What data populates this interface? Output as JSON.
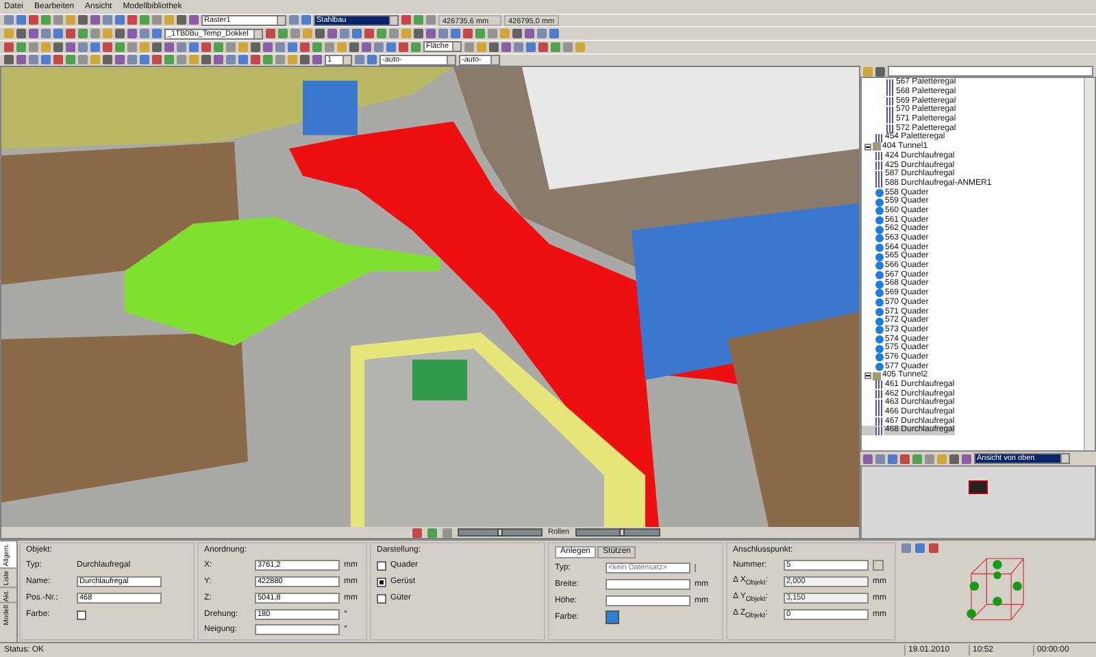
{
  "menu": [
    "Datei",
    "Bearbeiten",
    "Ansicht",
    "Modellbibliothek"
  ],
  "toolbar": {
    "layer": "Raster1",
    "material": "Stahlbau",
    "coord_x": "426735,6 mm",
    "coord_y": "426795,0 mm",
    "template": "_1TB0Bu_Temp_Dokkel",
    "fill": "Fläche",
    "size": "1",
    "auto_1": "-auto-",
    "auto_2": "-auto-"
  },
  "viewport": {
    "slider_label": "Rollen",
    "sliders": [
      {
        "level": 0.5
      },
      {
        "level": 0.55
      }
    ]
  },
  "tree": {
    "items": [
      {
        "children": [
          {
            "children": [
              {
                "label": "567 Paletteregal",
                "kind": "rack"
              },
              {
                "label": "568 Paletteregal",
                "kind": "rack"
              },
              {
                "label": "569 Paletteregal",
                "kind": "rack"
              },
              {
                "label": "570 Paletteregal",
                "kind": "rack"
              },
              {
                "label": "571 Paletteregal",
                "kind": "rack"
              },
              {
                "label": "572 Paletteregal",
                "kind": "rack"
              }
            ]
          },
          {
            "label": "454 Paletteregal",
            "kind": "rack"
          }
        ]
      },
      {
        "label": "404 Tunnel1",
        "kind": "group",
        "expanded": true,
        "children": [
          {
            "label": "424 Durchlaufregal",
            "kind": "rack"
          },
          {
            "label": "425 Durchlaufregal",
            "kind": "rack"
          },
          {
            "label": "587 Durchlaufregal",
            "kind": "rack"
          },
          {
            "label": "588 Durchlaufregal-ANMER1",
            "kind": "rack"
          },
          {
            "label": "558 Quader",
            "kind": "box"
          },
          {
            "label": "559 Quader",
            "kind": "box"
          },
          {
            "label": "560 Quader",
            "kind": "box"
          },
          {
            "label": "561 Quader",
            "kind": "box"
          },
          {
            "label": "562 Quader",
            "kind": "box"
          },
          {
            "label": "563 Quader",
            "kind": "box"
          },
          {
            "label": "564 Quader",
            "kind": "box"
          },
          {
            "label": "565 Quader",
            "kind": "box"
          },
          {
            "label": "566 Quader",
            "kind": "box"
          },
          {
            "label": "567 Quader",
            "kind": "box"
          },
          {
            "label": "568 Quader",
            "kind": "box"
          },
          {
            "label": "569 Quader",
            "kind": "box"
          },
          {
            "label": "570 Quader",
            "kind": "box"
          },
          {
            "label": "571 Quader",
            "kind": "box"
          },
          {
            "label": "572 Quader",
            "kind": "box"
          },
          {
            "label": "573 Quader",
            "kind": "box"
          },
          {
            "label": "574 Quader",
            "kind": "box"
          },
          {
            "label": "575 Quader",
            "kind": "box"
          },
          {
            "label": "576 Quader",
            "kind": "box"
          },
          {
            "label": "577 Quader",
            "kind": "box"
          }
        ]
      },
      {
        "label": "405 Tunnel2",
        "kind": "group",
        "expanded": true,
        "children": [
          {
            "label": "461 Durchlaufregal",
            "kind": "rack"
          },
          {
            "label": "462 Durchlaufregal",
            "kind": "rack"
          },
          {
            "label": "463 Durchlaufregal",
            "kind": "rack"
          },
          {
            "label": "466 Durchlaufregal",
            "kind": "rack"
          },
          {
            "label": "467 Durchlaufregal",
            "kind": "rack"
          },
          {
            "label": "468 Durchlaufregal",
            "kind": "rack",
            "selected": true
          }
        ]
      }
    ]
  },
  "view_panel": {
    "view": "Ansicht von oben"
  },
  "side_tabs": [
    {
      "label": "Allgem.",
      "selected": true
    },
    {
      "label": "Liste",
      "selected": false
    },
    {
      "label": "Akt.",
      "selected": false
    },
    {
      "label": "Modell",
      "selected": false
    }
  ],
  "sections": [
    {
      "title": "Objekt:",
      "rows": [
        {
          "kind": "text",
          "label": "Typ:",
          "value": "Durchlaufregal"
        },
        {
          "kind": "input",
          "label": "Name:",
          "value": "Durchlaufregal"
        },
        {
          "kind": "input",
          "label": "Pos.-Nr.:",
          "value": "468"
        },
        {
          "kind": "check",
          "label": "Farbe:",
          "checked": false
        }
      ]
    },
    {
      "title": "Anordnung:",
      "rows": [
        {
          "kind": "input",
          "label": "X:",
          "value": "3761,2",
          "unit": "mm"
        },
        {
          "kind": "input",
          "label": "Y:",
          "value": "422880",
          "unit": "mm"
        },
        {
          "kind": "input",
          "label": "Z:",
          "value": "5041,8",
          "unit": "mm"
        },
        {
          "kind": "input",
          "label": "Drehung:",
          "value": "180",
          "unit": "°"
        },
        {
          "kind": "input",
          "label": "Neigung:",
          "unit": "°"
        }
      ]
    },
    {
      "title": "Darstellung:",
      "rows": [
        {
          "kind": "checkbox",
          "label": "Quader",
          "checked": false
        },
        {
          "kind": "checkbox",
          "label": "Gerüst",
          "checked": true
        },
        {
          "kind": "checkbox",
          "label": "Güter",
          "checked": false
        }
      ]
    },
    {
      "tabs": [
        {
          "label": "Anlegen",
          "selected": true
        },
        {
          "label": "Stützen",
          "selected": false
        }
      ],
      "rows": [
        {
          "kind": "select",
          "label": "Typ:",
          "placeholder": "<kein Datensatz>"
        },
        {
          "kind": "input",
          "label": "Breite:",
          "unit": "mm"
        },
        {
          "kind": "input",
          "label": "Höhe:",
          "unit": "mm"
        },
        {
          "kind": "swatch",
          "label": "Farbe:"
        }
      ]
    },
    {
      "title": "Anschlusspunkt:",
      "rows": [
        {
          "kind": "spin",
          "label": "Nummer:",
          "value": "5"
        },
        {
          "kind": "input",
          "label": "Δ X$_{Objekt}$:",
          "value": "2,000",
          "unit": "mm",
          "disabled": true
        },
        {
          "kind": "input",
          "label": "Δ Y$_{Objekt}$:",
          "value": "3,150",
          "unit": "mm",
          "disabled": true
        },
        {
          "kind": "input",
          "label": "Δ Z$_{Objekt}$:",
          "value": "0",
          "unit": "mm"
        }
      ]
    }
  ],
  "status": {
    "text": "Status: OK",
    "date": "19.01.2010",
    "time": "10:52",
    "elapsed": "00:00:00"
  }
}
